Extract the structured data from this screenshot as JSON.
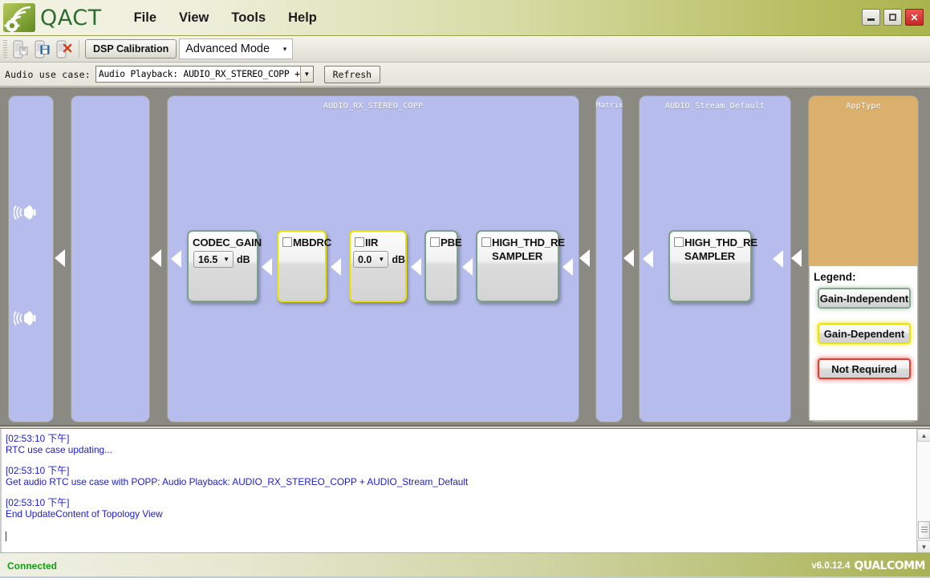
{
  "window": {
    "app_title": "QACT",
    "logo_icon": "qact-gear-wifi-logo",
    "controls": {
      "minimize": "minimize-icon",
      "maximize": "maximize-icon",
      "close": "✕"
    }
  },
  "menubar": {
    "items": [
      {
        "label": "File"
      },
      {
        "label": "View"
      },
      {
        "label": "Tools"
      },
      {
        "label": "Help"
      }
    ]
  },
  "toolbar": {
    "icons": [
      {
        "name": "save-device-icon"
      },
      {
        "name": "save-as-device-icon"
      },
      {
        "name": "delete-device-icon"
      }
    ],
    "dsp_tab_label": "DSP Calibration",
    "mode_value": "Advanced Mode",
    "mode_arrow": "▾"
  },
  "usecase": {
    "label": "Audio use case:",
    "value": "Audio Playback: AUDIO_RX_STEREO_COPP + AUDIO_Stream_Default",
    "dropdown_arrow": "▼",
    "refresh_label": "Refresh"
  },
  "topology": {
    "panels": [
      {
        "name": "device-panel",
        "title": "",
        "color": "#b6bdec"
      },
      {
        "name": "device-group-panel",
        "title": "",
        "color": "#b6bdec"
      },
      {
        "name": "copp-panel",
        "title": "AUDIO_RX_STEREO_COPP",
        "color": "#b6bdec"
      },
      {
        "name": "matrix-panel",
        "title": "Matrix",
        "color": "#b6bdec"
      },
      {
        "name": "stream-panel",
        "title": "AUDIO_Stream_Default",
        "color": "#b6bdec"
      },
      {
        "name": "apptype-panel",
        "title": "AppType",
        "color": "#dbb06c"
      }
    ],
    "modules": [
      {
        "name": "CODEC_GAIN",
        "has_checkbox": false,
        "checked": false,
        "type": "gain-independent",
        "gain_value": "16.5",
        "gain_unit": "dB"
      },
      {
        "name": "MBDRC",
        "has_checkbox": true,
        "checked": false,
        "type": "gain-dependent",
        "gain_value": null,
        "gain_unit": null
      },
      {
        "name": "IIR",
        "has_checkbox": true,
        "checked": false,
        "type": "gain-dependent",
        "gain_value": "0.0",
        "gain_unit": "dB"
      },
      {
        "name": "PBE",
        "has_checkbox": true,
        "checked": false,
        "type": "gain-independent",
        "gain_value": null,
        "gain_unit": null
      },
      {
        "name": "HIGH_THD_RE SAMPLER",
        "name_line1": "HIGH_THD_RE",
        "name_line2": "SAMPLER",
        "has_checkbox": true,
        "checked": false,
        "type": "gain-independent",
        "gain_value": null,
        "gain_unit": null
      },
      {
        "name": "HIGH_THD_RE SAMPLER",
        "name_line1": "HIGH_THD_RE",
        "name_line2": "SAMPLER",
        "has_checkbox": true,
        "checked": false,
        "type": "gain-independent",
        "gain_value": null,
        "gain_unit": null
      }
    ],
    "speaker_icon": "speaker-icon",
    "flow_arrow": "◀"
  },
  "legend": {
    "title": "Legend:",
    "items": [
      {
        "label": "Gain-Independent",
        "style": "ind",
        "color": "#7aa08a"
      },
      {
        "label": "Gain-Dependent",
        "style": "dep",
        "color": "#ece400"
      },
      {
        "label": "Not Required",
        "style": "not",
        "color": "#e23b30"
      }
    ]
  },
  "log": {
    "entries": [
      {
        "timestamp": "[02:53:10 下午]",
        "message": "RTC use case updating..."
      },
      {
        "timestamp": "[02:53:10 下午]",
        "message": "Get audio RTC use case with POPP: Audio Playback: AUDIO_RX_STEREO_COPP + AUDIO_Stream_Default"
      },
      {
        "timestamp": "[02:53:10 下午]",
        "message": "End UpdateContent of Topology View"
      }
    ],
    "scroll_up_arrow": "▲",
    "scroll_down_arrow": "▼"
  },
  "statusbar": {
    "connection": "Connected",
    "connection_color": "#12a012",
    "version": "v6.0.12.4",
    "brand": "QUALCOMM"
  }
}
